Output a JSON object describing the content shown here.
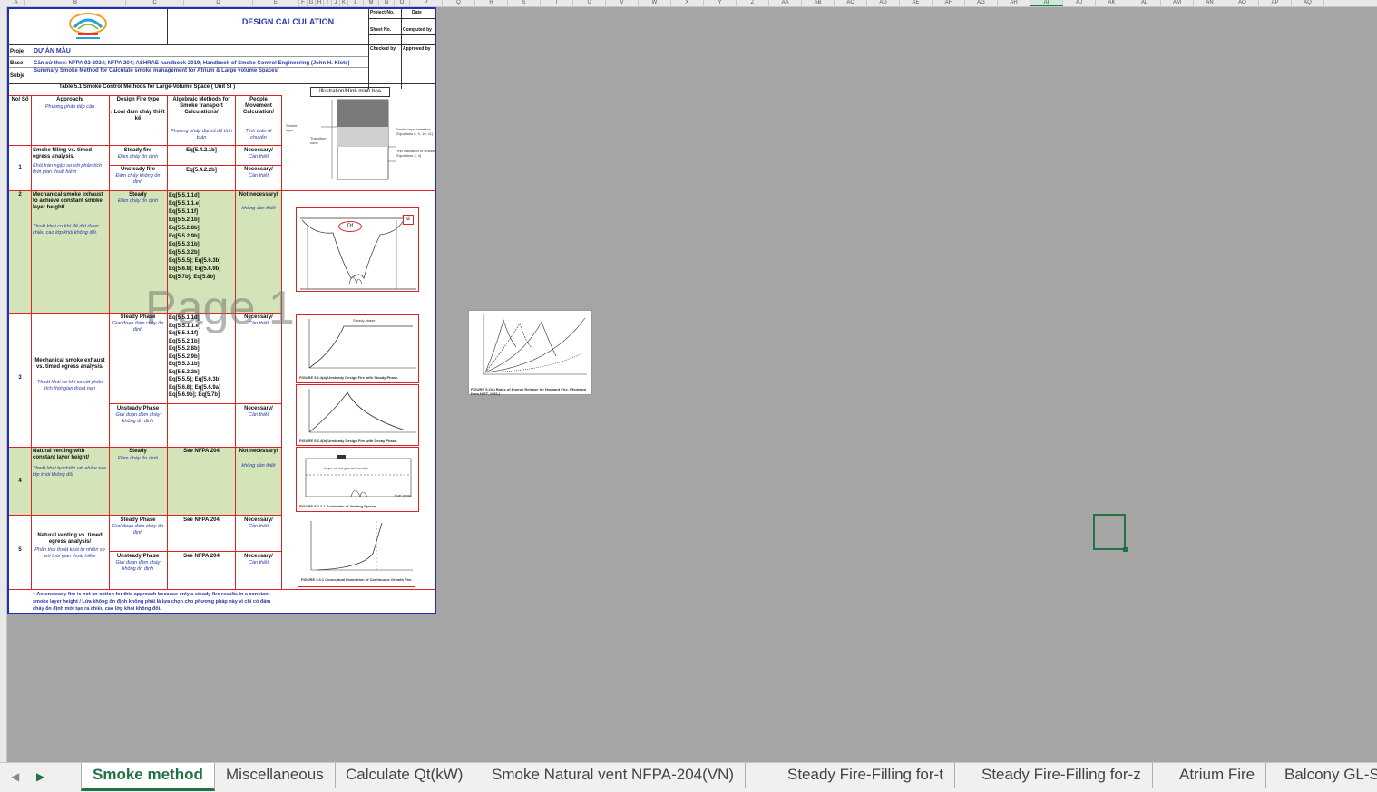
{
  "columns": [
    "A",
    "B",
    "C",
    "D",
    "E",
    "F",
    "G",
    "H",
    "I",
    "J",
    "K",
    "L",
    "M",
    "N",
    "O",
    "P",
    "Q",
    "R",
    "S",
    "T",
    "U",
    "V",
    "W",
    "X",
    "Y",
    "Z",
    "AA",
    "AB",
    "AC",
    "AD",
    "AE",
    "AF",
    "AG",
    "AH",
    "AI",
    "AJ",
    "AK",
    "AL",
    "AM",
    "AN",
    "AO",
    "AP",
    "AQ"
  ],
  "selected_column": "AI",
  "header": {
    "title": "DESIGN CALCULATION",
    "labels": {
      "project_no": "Project No.",
      "date": "Date",
      "sheet_no": "Sheet No.",
      "computed_by": "Computed by",
      "checked_by": "Checked by",
      "approved_by": "Approved by"
    },
    "project_label": "Proje",
    "project_value": "DỰ ÁN MẪU",
    "base_label": "Base:",
    "base_value": "Căn cứ theo: NFPA 92-2024; NFPA 204; ASHRAE handbook 2019; Handbook of Smoke Control Engineering (John H. Klote)",
    "subject_label": "Subje",
    "subject_value": "Summary Smoke Method for Calculate smoke management for Atrium & Large volume Spaces/",
    "table_title": "Table 5.1 Smoke Control Methods for Large-Volume Space ( Unit SI )",
    "illustration": "Illustration/Hình minh họa"
  },
  "table_header": {
    "no": "No/ Số",
    "approach": "Approach/",
    "approach_vn": "Phương pháp tiếp cận",
    "fire": "Design Fire type",
    "fire_sub": "/ Loại đám cháy thiết kế",
    "alg": "Algebraic Methods for Smoke transport Calculations/",
    "alg_vn": "Phương pháp đại số để tính toán",
    "people": "People Movement Calculation/",
    "people_vn": "Tính toán di chuyển"
  },
  "rows": {
    "r1": {
      "no": "1",
      "approach": "Smoke filling vs. timed egress analysis.",
      "approach_vn": "Khói tràn ngập so với phân tích thời gian thoát hiểm",
      "fire1": "Steady fire",
      "fire1_vn": "Đám cháy ổn định",
      "fire2": "Unsteady fire",
      "fire2_vn": "Đám cháy không ổn định",
      "alg1": "Eq[5.4.2.1b]",
      "alg2": "Eq[5.4.2.2b]",
      "people1": "Necessary/",
      "people1_vn": "Cần thiết",
      "people2": "Necessary/",
      "people2_vn": "Cần thiết"
    },
    "r2": {
      "no": "2",
      "approach": "Mechanical smoke exhaust to achieve constant smoke layer height/",
      "approach_vn": "Thoát khói cơ khí để đạt được chiều cao lớp khói không đổi.",
      "fire": "Steady",
      "fire_vn": "Đám cháy ổn định",
      "alg": "Eq[5.5.1.1d]\nEq[5.5.1.1.e]\nEq[5.5.1.1f]\nEq[5.5.2.1b]\nEq[5.5.2.8b]\nEq[5.5.2.9b]\nEq[5.5.3.1b]\nEq[5.5.3.2b]\nEq[5.5.5]; Eq[5.6.3b]\nEq[5.6.8]; Eq[5.6.9b]\nEq[5.7b]; Eq[5.8b]",
      "people": "Not necessary/",
      "people_vn": "không cần thiết",
      "df_label": "Df",
      "d_label": "d"
    },
    "r3": {
      "no": "3",
      "approach": "Mechanical smoke exhaust vs. timed egress analysis/",
      "approach_vn": "Thoát khói cơ khí so với phân tích thời gian thoát nạn",
      "fire1": "Steady Phase",
      "fire1_vn": "Giai đoạn đám cháy ổn định",
      "fire2": "Unsteady Phase",
      "fire2_vn": "Giai đoạn đám cháy không ổn định",
      "alg": "Eq[5.5.1.1d]\nEq[5.5.1.1.e]\nEq[5.5.1.1f]\nEq[5.5.2.1b]\nEq[5.5.2.8b]\nEq[5.5.2.9b]\nEq[5.5.3.1b]\nEq[5.5.3.2b]\nEq[5.5.5]; Eq[5.6.3b]\nEq[5.6.8]; Eq[5.6.9a]\nEq[5.6.9b]; Eq[5.7b]",
      "people1": "Necessary/",
      "people1_vn": "Cần thiết",
      "people2": "Necessary/",
      "people2_vn": "Cần thiết",
      "fig1_caption": "FIGURE 5.2.4(a) Unsteady Design Fire with Steady Phase.",
      "fig2_caption": "FIGURE 5.2.4(b) Unsteady Design Fire with Decay Phase."
    },
    "r4": {
      "no": "4",
      "approach": "Natural venting with constant layer height/",
      "approach_vn": "Thoát khói tự nhiên với chiều cao lớp khói không đổi",
      "fire": "Steady",
      "fire_vn": "Đám cháy ổn định",
      "alg": "See NFPA 204",
      "people": "Not necessary/",
      "people_vn": "không cần thiết",
      "fig_caption": "FIGURE 9.2.2.1 Schematic of Venting System."
    },
    "r5": {
      "no": "5",
      "approach": "Natural venting vs. timed egress analysis/",
      "approach_vn": "Phân tích thoát khói tự nhiên so với thời gian thoát hiểm",
      "fire1": "Steady Phase",
      "fire1_vn": "Giai đoạn đám cháy ổn định",
      "fire2": "Unsteady Phase",
      "fire2_vn": "Giai đoạn đám cháy không ổn định",
      "alg1": "See NFPA 204",
      "alg2": "See NFPA 204",
      "people1": "Necessary/",
      "people1_vn": "Cần thiết",
      "people2": "Necessary/",
      "people2_vn": "Cần thiết",
      "fig_caption": "FIGURE 9.3.1 Conceptual Illustration of Continuous Growth Fire."
    }
  },
  "footnote": "† An unsteady fire is not an option for this approach because only a steady fire results in a constant smoke layer height / Lửa không ổn định không phải là lựa chọn cho phương pháp này vì chỉ có đám cháy ổn định mới tạo ra chiều cao lớp khói không đổi.",
  "watermark": "Page 1",
  "fig_labels": {
    "smoke_layer": "Smoke layer",
    "transition": "Transition zone",
    "interface": "Smoke layer interface (Equations 8, 9, 10, 11)",
    "first_indication": "First indication of smoke (Equations 3, 4)",
    "steady_phase": "Steady phase",
    "layer_hot": "Layer of hot gas and smoke",
    "fuel_array": "Fuel array",
    "outside_caption": "FIGURE 5.2(a) Rates of Energy Release for Hypoard Fire. (Redrawn from NIST, 1981.)"
  },
  "tabs": [
    {
      "label": "Smoke method",
      "active": true
    },
    {
      "label": "Miscellaneous",
      "active": false
    },
    {
      "label": "Calculate Qt(kW)",
      "active": false
    },
    {
      "label": "Smoke Natural vent NFPA-204(VN)",
      "active": false
    },
    {
      "label": "Steady Fire-Filling for-t",
      "active": false
    },
    {
      "label": "Steady Fire-Filling for-z",
      "active": false
    },
    {
      "label": "Atrium Fire",
      "active": false
    },
    {
      "label": "Balcony GL-SI",
      "active": false
    }
  ],
  "colors": {
    "accent": "#217346",
    "border_blue": "#1f2fb8",
    "red": "#dd2222",
    "green_fill": "#d3e4b8"
  }
}
